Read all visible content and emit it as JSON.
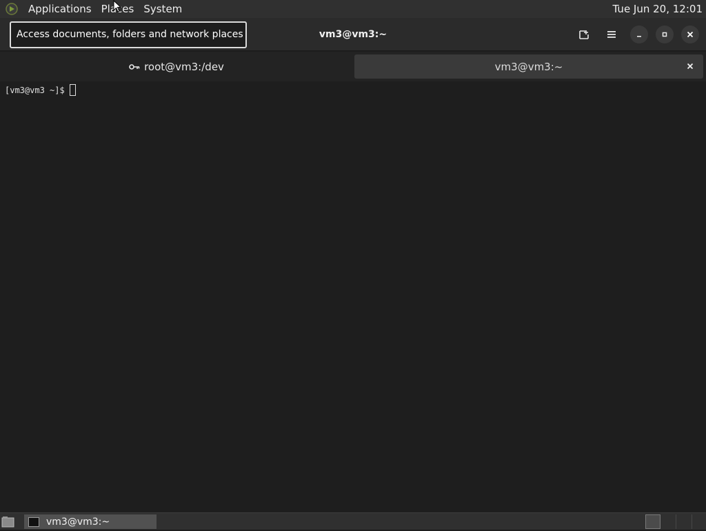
{
  "top_panel": {
    "menus": [
      "Applications",
      "Places",
      "System"
    ],
    "clock": "Tue Jun 20, 12:01"
  },
  "tooltip": "Access documents, folders and network places",
  "window": {
    "title": "vm3@vm3:~"
  },
  "tabs": [
    {
      "label": "root@vm3:/dev",
      "active": false,
      "icon": "key-icon"
    },
    {
      "label": "vm3@vm3:~",
      "active": true
    }
  ],
  "terminal": {
    "prompt": "[vm3@vm3 ~]$"
  },
  "taskbar": {
    "window_label": "vm3@vm3:~"
  },
  "colors": {
    "panel": "#303030",
    "terminal_bg": "#1e1e1e",
    "active_tab": "#3a3a3a"
  }
}
